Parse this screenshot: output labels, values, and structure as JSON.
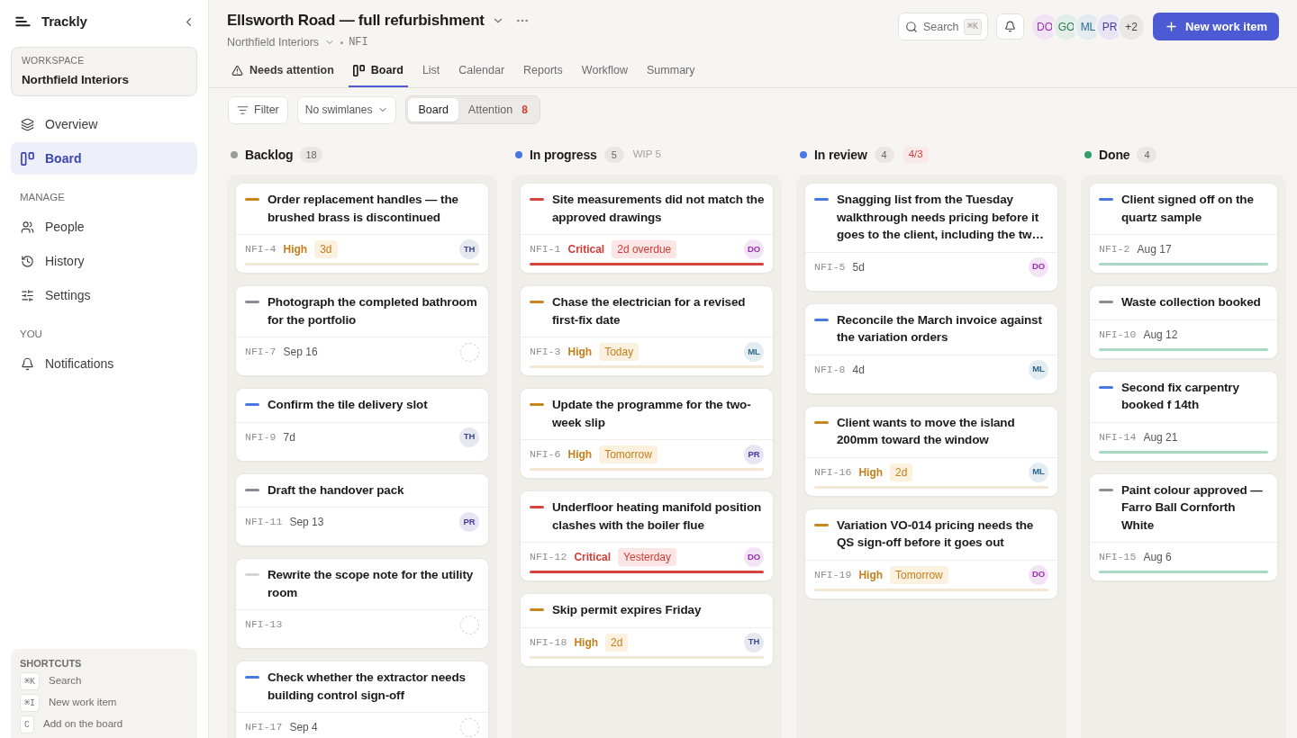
{
  "sidebar": {
    "brand": "Trackly",
    "workspace": {
      "label": "WORKSPACE",
      "name": "Northfield Interiors"
    },
    "sections": [
      {
        "items": [
          {
            "label": "Overview",
            "kind": "overview",
            "selected": false
          },
          {
            "label": "Board",
            "kind": "board",
            "selected": true
          }
        ]
      },
      {
        "heading": "MANAGE",
        "items": [
          {
            "label": "People",
            "kind": "people",
            "selected": false
          },
          {
            "label": "History",
            "kind": "history",
            "selected": false
          },
          {
            "label": "Settings",
            "kind": "settings",
            "selected": false
          }
        ]
      },
      {
        "heading": "YOU",
        "items": [
          {
            "label": "Notifications",
            "kind": "notifications",
            "selected": false
          }
        ]
      }
    ],
    "shortcuts": {
      "heading": "SHORTCUTS",
      "items": [
        {
          "key": "⌘K",
          "label": "Search"
        },
        {
          "key": "⌘I",
          "label": "New work item"
        },
        {
          "key": "C",
          "label": "Add on the board"
        }
      ]
    }
  },
  "header": {
    "title": "Ellsworth Road — full refurbishment",
    "workspace": "Northfield Interiors",
    "project_key": "NFI",
    "search": {
      "placeholder": "Search",
      "shortcut": "⌘K"
    },
    "members": [
      {
        "initials": "DO",
        "color": "#9a2fb0"
      },
      {
        "initials": "GO",
        "color": "#2a7a52"
      },
      {
        "initials": "ML",
        "color": "#2b6a8c"
      },
      {
        "initials": "PR",
        "color": "#4a3aa0"
      }
    ],
    "more_members": "+2",
    "primary_button": "New work item"
  },
  "tabs": [
    {
      "label": "Needs attention",
      "kind": "attention",
      "selected": false
    },
    {
      "label": "Board",
      "kind": "board",
      "selected": true
    },
    {
      "label": "List",
      "kind": "view",
      "selected": false
    },
    {
      "label": "Calendar",
      "kind": "view",
      "selected": false
    },
    {
      "label": "Reports",
      "kind": "view",
      "selected": false
    },
    {
      "label": "Workflow",
      "kind": "view",
      "selected": false
    },
    {
      "label": "Summary",
      "kind": "view",
      "selected": false
    }
  ],
  "toolbar": {
    "filter": "Filter",
    "swimlanes": "No swimlanes",
    "segments": [
      {
        "label": "Board",
        "selected": true
      },
      {
        "label": "Attention",
        "selected": false,
        "count": "8"
      }
    ]
  },
  "columns": [
    {
      "name": "Backlog",
      "color": "#9b9b9b",
      "count": "18",
      "cards": [
        {
          "id": "NFI-4",
          "title": "Order replacement handles — the brushed brass is discontinued",
          "priority": {
            "kind": "high",
            "label": "High"
          },
          "due": {
            "text": "3d",
            "kind": "warning"
          },
          "assignee": {
            "kind": "person",
            "initials": "TH",
            "color": "#3b4d8f"
          },
          "stripe": {
            "kind": "warning"
          }
        },
        {
          "id": "NFI-7",
          "title": "Photograph the completed bathroom for the portfolio",
          "priority": {
            "kind": "low"
          },
          "due": {
            "text": "Sep 16",
            "kind": "plain"
          },
          "assignee": {
            "kind": "unassigned"
          }
        },
        {
          "id": "NFI-9",
          "title": "Confirm the tile delivery slot",
          "priority": {
            "kind": "medium"
          },
          "due": {
            "text": "7d",
            "kind": "plain"
          },
          "assignee": {
            "kind": "person",
            "initials": "TH",
            "color": "#3b4d8f"
          }
        },
        {
          "id": "NFI-11",
          "title": "Draft the handover pack",
          "priority": {
            "kind": "low"
          },
          "due": {
            "text": "Sep 13",
            "kind": "plain"
          },
          "assignee": {
            "kind": "person",
            "initials": "PR",
            "color": "#4a3aa0"
          }
        },
        {
          "id": "NFI-13",
          "title": "Rewrite the scope note for the utility room",
          "priority": {
            "kind": "none"
          },
          "assignee": {
            "kind": "unassigned"
          }
        },
        {
          "id": "NFI-17",
          "title": "Check whether the extractor needs building control sign-off",
          "priority": {
            "kind": "medium"
          },
          "due": {
            "text": "Sep 4",
            "kind": "plain"
          },
          "assignee": {
            "kind": "unassigned"
          }
        }
      ]
    },
    {
      "name": "In progress",
      "color": "#4a78e0",
      "count": "5",
      "limit": {
        "text": "WIP 5",
        "exceeded": false
      },
      "cards": [
        {
          "id": "NFI-1",
          "title": "Site measurements did not match the approved drawings",
          "priority": {
            "kind": "critical",
            "label": "Critical"
          },
          "due": {
            "text": "2d overdue",
            "kind": "danger"
          },
          "assignee": {
            "kind": "person",
            "initials": "DO",
            "color": "#9a2fb0"
          },
          "stripe": {
            "kind": "danger"
          }
        },
        {
          "id": "NFI-3",
          "title": "Chase the electrician for a revised first-fix date",
          "priority": {
            "kind": "high",
            "label": "High"
          },
          "due": {
            "text": "Today",
            "kind": "warning"
          },
          "assignee": {
            "kind": "person",
            "initials": "ML",
            "color": "#2b6a8c"
          },
          "stripe": {
            "kind": "warning"
          }
        },
        {
          "id": "NFI-6",
          "title": "Update the programme for the two-week slip",
          "priority": {
            "kind": "high",
            "label": "High"
          },
          "due": {
            "text": "Tomorrow",
            "kind": "warning"
          },
          "assignee": {
            "kind": "person",
            "initials": "PR",
            "color": "#4a3aa0"
          },
          "stripe": {
            "kind": "warning"
          }
        },
        {
          "id": "NFI-12",
          "title": "Underfloor heating manifold position clashes with the boiler flue",
          "priority": {
            "kind": "critical",
            "label": "Critical"
          },
          "due": {
            "text": "Yesterday",
            "kind": "danger"
          },
          "assignee": {
            "kind": "person",
            "initials": "DO",
            "color": "#9a2fb0"
          },
          "stripe": {
            "kind": "danger"
          }
        },
        {
          "id": "NFI-18",
          "title": "Skip permit expires Friday",
          "priority": {
            "kind": "high",
            "label": "High"
          },
          "due": {
            "text": "2d",
            "kind": "warning"
          },
          "assignee": {
            "kind": "person",
            "initials": "TH",
            "color": "#3b4d8f"
          },
          "stripe": {
            "kind": "warning"
          }
        }
      ]
    },
    {
      "name": "In review",
      "color": "#4a78e0",
      "count": "4",
      "limit": {
        "text": "4/3",
        "exceeded": true
      },
      "cards": [
        {
          "id": "NFI-5",
          "title": "Snagging list from the Tuesday walkthrough needs pricing before it goes to the client, including the tw…",
          "priority": {
            "kind": "medium"
          },
          "due": {
            "text": "5d",
            "kind": "plain"
          },
          "assignee": {
            "kind": "person",
            "initials": "DO",
            "color": "#9a2fb0"
          }
        },
        {
          "id": "NFI-8",
          "title": "Reconcile the March invoice against the variation orders",
          "priority": {
            "kind": "medium"
          },
          "due": {
            "text": "4d",
            "kind": "plain"
          },
          "assignee": {
            "kind": "person",
            "initials": "ML",
            "color": "#2b6a8c"
          }
        },
        {
          "id": "NFI-16",
          "title": "Client wants to move the island 200mm toward the window",
          "priority": {
            "kind": "high",
            "label": "High"
          },
          "due": {
            "text": "2d",
            "kind": "warning"
          },
          "assignee": {
            "kind": "person",
            "initials": "ML",
            "color": "#2b6a8c"
          },
          "stripe": {
            "kind": "warning"
          }
        },
        {
          "id": "NFI-19",
          "title": "Variation VO-014 pricing needs the QS sign-off before it goes out",
          "priority": {
            "kind": "high",
            "label": "High"
          },
          "due": {
            "text": "Tomorrow",
            "kind": "warning"
          },
          "assignee": {
            "kind": "person",
            "initials": "DO",
            "color": "#9a2fb0"
          },
          "stripe": {
            "kind": "warning"
          }
        }
      ]
    },
    {
      "name": "Done",
      "color": "#2f9e6b",
      "count": "4",
      "cards": [
        {
          "id": "NFI-2",
          "title": "Client signed off on the quartz sample",
          "priority": {
            "kind": "medium"
          },
          "due": {
            "text": "Aug 17",
            "kind": "plain"
          },
          "stripe": {
            "kind": "success"
          }
        },
        {
          "id": "NFI-10",
          "title": "Waste collection booked",
          "priority": {
            "kind": "low"
          },
          "due": {
            "text": "Aug 12",
            "kind": "plain"
          },
          "stripe": {
            "kind": "success"
          }
        },
        {
          "id": "NFI-14",
          "title": "Second fix carpentry booked f 14th",
          "priority": {
            "kind": "medium"
          },
          "due": {
            "text": "Aug 21",
            "kind": "plain"
          },
          "stripe": {
            "kind": "success"
          }
        },
        {
          "id": "NFI-15",
          "title": "Paint colour approved — Farro Ball Cornforth White",
          "priority": {
            "kind": "low"
          },
          "due": {
            "text": "Aug 6",
            "kind": "plain"
          },
          "stripe": {
            "kind": "success"
          }
        }
      ]
    }
  ]
}
